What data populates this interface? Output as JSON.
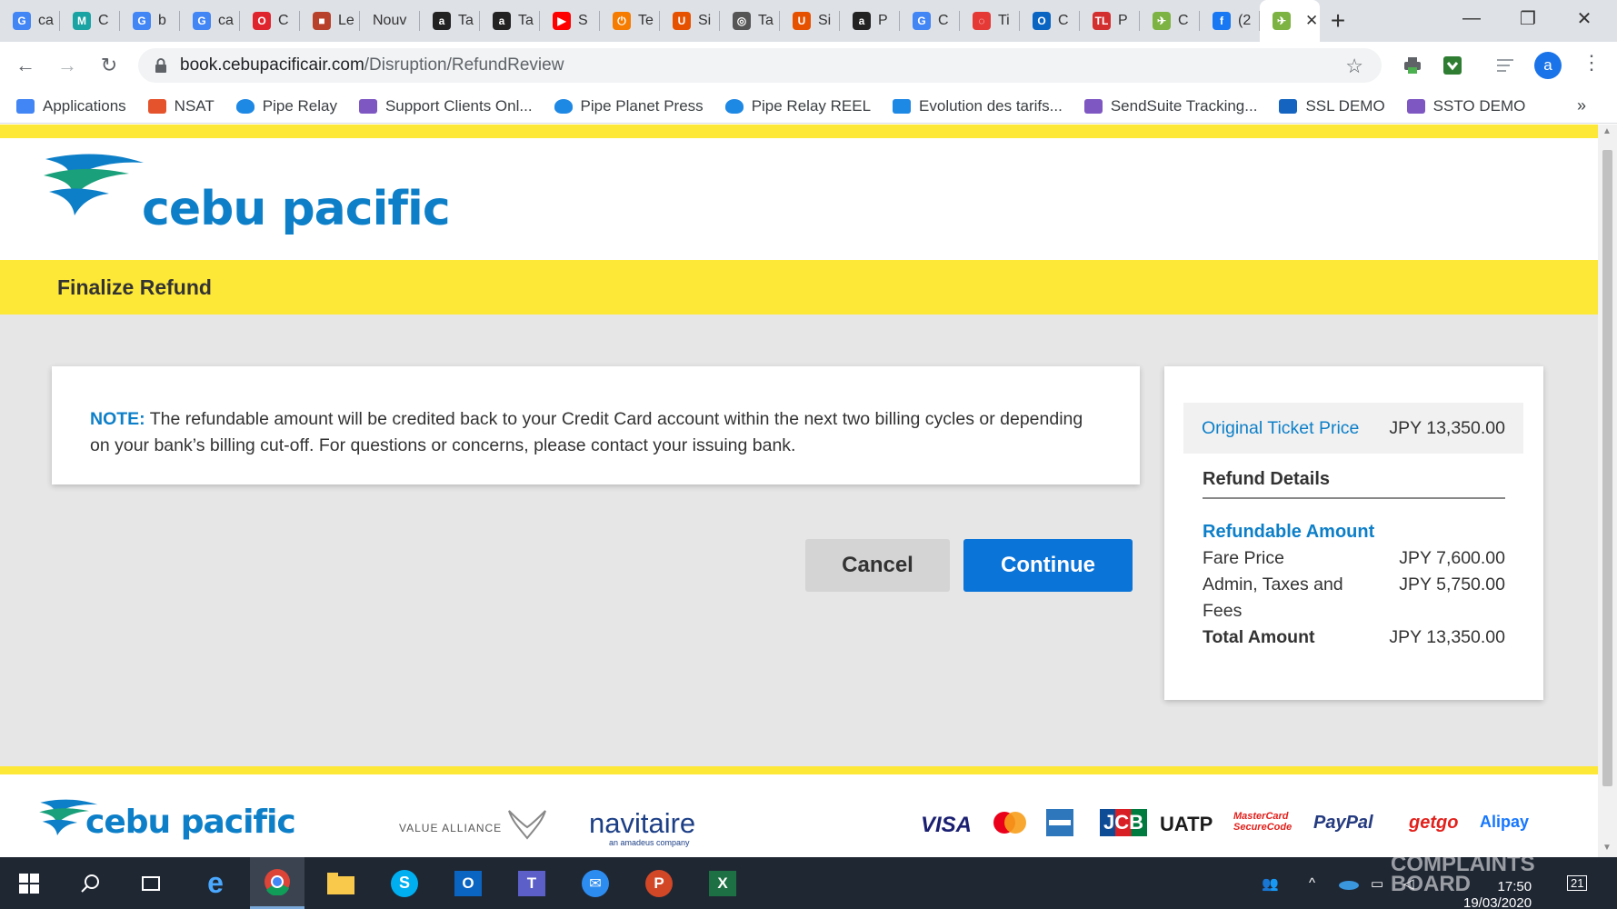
{
  "browser": {
    "tabs": [
      {
        "title": "ca",
        "icon": "google-icon",
        "color": "#4285f4",
        "glyph": "G"
      },
      {
        "title": "C",
        "icon": "m-icon",
        "color": "#1aa3a3",
        "glyph": "M"
      },
      {
        "title": "b",
        "icon": "google-icon",
        "color": "#4285f4",
        "glyph": "G"
      },
      {
        "title": "ca",
        "icon": "google-icon",
        "color": "#4285f4",
        "glyph": "G"
      },
      {
        "title": "C",
        "icon": "opera-icon",
        "color": "#e0242e",
        "glyph": "O"
      },
      {
        "title": "Le",
        "icon": "briefcase-icon",
        "color": "#b7412a",
        "glyph": "■"
      },
      {
        "title": "Nouv",
        "icon": "",
        "color": "",
        "glyph": ""
      },
      {
        "title": "Ta",
        "icon": "amazon-icon",
        "color": "#222222",
        "glyph": "a"
      },
      {
        "title": "Ta",
        "icon": "amazon-icon",
        "color": "#222222",
        "glyph": "a"
      },
      {
        "title": "S",
        "icon": "youtube-icon",
        "color": "#ff0000",
        "glyph": "▶"
      },
      {
        "title": "Te",
        "icon": "power-icon",
        "color": "#f57c00",
        "glyph": "⏻"
      },
      {
        "title": "Si",
        "icon": "u-icon",
        "color": "#e65100",
        "glyph": "U"
      },
      {
        "title": "Ta",
        "icon": "globe-icon",
        "color": "#555555",
        "glyph": "◎"
      },
      {
        "title": "Si",
        "icon": "u-icon",
        "color": "#e65100",
        "glyph": "U"
      },
      {
        "title": "P",
        "icon": "amazon-icon",
        "color": "#222222",
        "glyph": "a"
      },
      {
        "title": "C",
        "icon": "google-icon",
        "color": "#4285f4",
        "glyph": "G"
      },
      {
        "title": "Ti",
        "icon": "bell-icon",
        "color": "#e53935",
        "glyph": "◌"
      },
      {
        "title": "C",
        "icon": "outlook-icon",
        "color": "#0a64c2",
        "glyph": "O"
      },
      {
        "title": "P",
        "icon": "tl-icon",
        "color": "#d32f2f",
        "glyph": "TL"
      },
      {
        "title": "C",
        "icon": "cebu-icon",
        "color": "#7cb342",
        "glyph": "✈"
      },
      {
        "title": "(2",
        "icon": "facebook-icon",
        "color": "#1877f2",
        "glyph": "f"
      },
      {
        "title": "",
        "icon": "cebu-icon",
        "color": "#7cb342",
        "glyph": "✈"
      }
    ],
    "url_host": "book.cebupacificair.com",
    "url_path": "/Disruption/RefundReview",
    "avatar_letter": "a",
    "bookmarks": [
      {
        "label": "Applications",
        "icon": "apps-grid-icon",
        "color": "#4285f4"
      },
      {
        "label": "NSAT",
        "icon": "nsat-icon",
        "color": "#e5532d"
      },
      {
        "label": "Pipe Relay",
        "icon": "cloud-icon",
        "color": "#1e88e5"
      },
      {
        "label": "Support Clients Onl...",
        "icon": "sendsuite-icon",
        "color": "#7e57c2"
      },
      {
        "label": "Pipe Planet Press",
        "icon": "cloud-icon",
        "color": "#1e88e5"
      },
      {
        "label": "Pipe Relay REEL",
        "icon": "cloud-icon",
        "color": "#1e88e5"
      },
      {
        "label": "Evolution des tarifs...",
        "icon": "chart-icon",
        "color": "#1e88e5"
      },
      {
        "label": "SendSuite Tracking...",
        "icon": "sendsuite-icon",
        "color": "#7e57c2"
      },
      {
        "label": "SSL DEMO",
        "icon": "ssl-icon",
        "color": "#1565c0"
      },
      {
        "label": "SSTO DEMO",
        "icon": "sendsuite-icon",
        "color": "#7e57c2"
      }
    ]
  },
  "page": {
    "brand": "cebu pacific",
    "heading": "Finalize Refund",
    "note_label": "NOTE:",
    "note_text": " The refundable amount will be credited back to your Credit Card account within the next two billing cycles or depending on your bank’s billing cut-off. For questions or concerns, please contact your issuing bank.",
    "cancel_label": "Cancel",
    "continue_label": "Continue",
    "summary": {
      "original_label": "Original Ticket Price",
      "original_value": "JPY 13,350.00",
      "details_title": "Refund Details",
      "refundable_title": "Refundable Amount",
      "rows": [
        {
          "label": "Fare Price",
          "value": "JPY 7,600.00"
        },
        {
          "label": "Admin, Taxes and Fees",
          "value": "JPY 5,750.00"
        }
      ],
      "total_label": "Total Amount",
      "total_value": "JPY 13,350.00"
    },
    "footer": {
      "brand": "cebu pacific",
      "alliance": "VALUE ALLIANCE",
      "navitaire": "navitaire",
      "navitaire_sub": "an amadeus company",
      "payments": [
        "VISA",
        "mastercard-icon",
        "amex-icon",
        "JCB",
        "UATP",
        "MasterCard SecureCode",
        "PayPal",
        "getgo",
        "Alipay"
      ]
    }
  },
  "taskbar": {
    "clock_time": "17:50",
    "clock_date": "19/03/2020",
    "notification_count": "21",
    "watermark": "COMPLAINTS BOARD"
  },
  "colors": {
    "brand_blue": "#0d7fc8",
    "brand_yellow": "#fde737",
    "button_blue": "#0b74d8"
  }
}
